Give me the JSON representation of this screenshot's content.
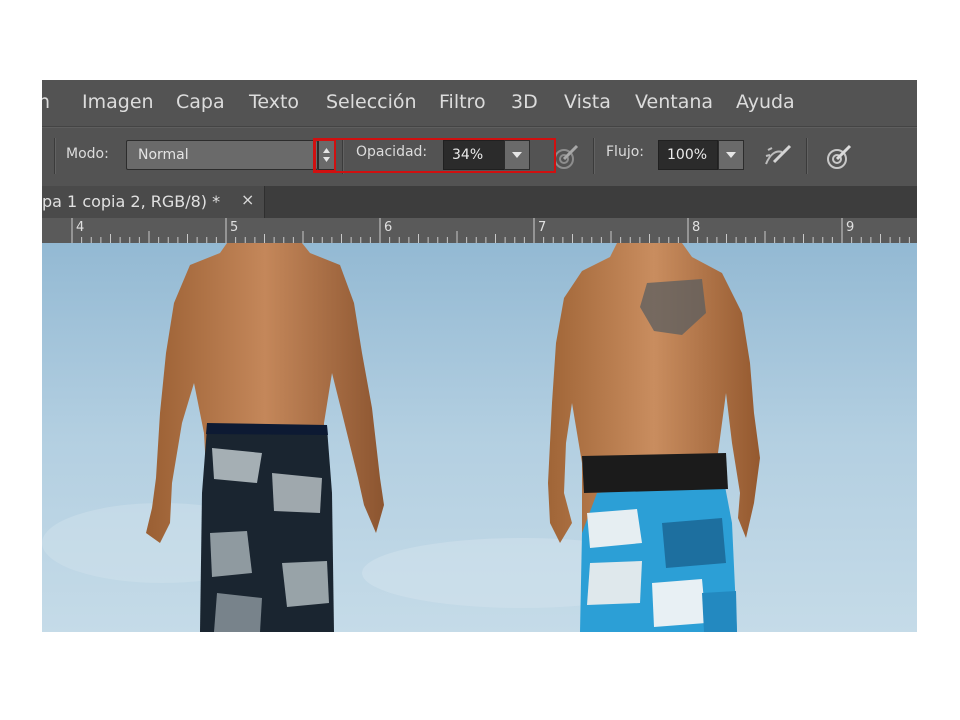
{
  "menu": {
    "items": [
      "n",
      "Imagen",
      "Capa",
      "Texto",
      "Selección",
      "Filtro",
      "3D",
      "Vista",
      "Ventana",
      "Ayuda"
    ]
  },
  "options": {
    "mode_label": "Modo:",
    "mode_value": "Normal",
    "opacity_label": "Opacidad:",
    "opacity_value": "34%",
    "flow_label": "Flujo:",
    "flow_value": "100%"
  },
  "document": {
    "tab_title": "pa 1 copia 2, RGB/8) *",
    "close_symbol": "×"
  },
  "ruler": {
    "labels": [
      "4",
      "5",
      "6",
      "7",
      "8",
      "9"
    ]
  },
  "canvas": {
    "description_icons": [
      "person-left",
      "person-right"
    ]
  },
  "colors": {
    "highlight": "#d01010",
    "menubar": "#535353",
    "sky": "#a9c9de"
  }
}
